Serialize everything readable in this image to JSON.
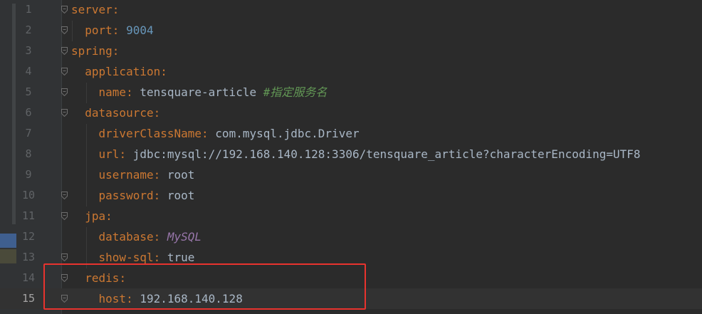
{
  "editor": {
    "language": "yaml",
    "current_line": "15",
    "lines": [
      {
        "number": "1",
        "parts": [
          {
            "t": "server",
            "c": "key"
          },
          {
            "t": ":",
            "c": "punct"
          }
        ]
      },
      {
        "number": "2",
        "parts": [
          {
            "t": "  "
          },
          {
            "t": "port",
            "c": "key"
          },
          {
            "t": ": ",
            "c": "punct"
          },
          {
            "t": "9004",
            "c": "num"
          }
        ]
      },
      {
        "number": "3",
        "parts": [
          {
            "t": "spring",
            "c": "key"
          },
          {
            "t": ":",
            "c": "punct"
          }
        ]
      },
      {
        "number": "4",
        "parts": [
          {
            "t": "  "
          },
          {
            "t": "application",
            "c": "key"
          },
          {
            "t": ":",
            "c": "punct"
          }
        ]
      },
      {
        "number": "5",
        "parts": [
          {
            "t": "    "
          },
          {
            "t": "name",
            "c": "key"
          },
          {
            "t": ": ",
            "c": "punct"
          },
          {
            "t": "tensquare-article ",
            "c": "val"
          },
          {
            "t": "#指定服务名",
            "c": "comment"
          }
        ]
      },
      {
        "number": "6",
        "parts": [
          {
            "t": "  "
          },
          {
            "t": "datasource",
            "c": "key"
          },
          {
            "t": ":",
            "c": "punct"
          }
        ]
      },
      {
        "number": "7",
        "parts": [
          {
            "t": "    "
          },
          {
            "t": "driverClassName",
            "c": "key"
          },
          {
            "t": ": ",
            "c": "punct"
          },
          {
            "t": "com.mysql.jdbc.Driver",
            "c": "val"
          }
        ]
      },
      {
        "number": "8",
        "parts": [
          {
            "t": "    "
          },
          {
            "t": "url",
            "c": "key"
          },
          {
            "t": ": ",
            "c": "punct"
          },
          {
            "t": "jdbc:mysql://192.168.140.128:3306/tensquare_article?characterEncoding=UTF8",
            "c": "val"
          }
        ]
      },
      {
        "number": "9",
        "parts": [
          {
            "t": "    "
          },
          {
            "t": "username",
            "c": "key"
          },
          {
            "t": ": ",
            "c": "punct"
          },
          {
            "t": "root",
            "c": "val"
          }
        ]
      },
      {
        "number": "10",
        "parts": [
          {
            "t": "    "
          },
          {
            "t": "password",
            "c": "key"
          },
          {
            "t": ": ",
            "c": "punct"
          },
          {
            "t": "root",
            "c": "val"
          }
        ]
      },
      {
        "number": "11",
        "parts": [
          {
            "t": "  "
          },
          {
            "t": "jpa",
            "c": "key"
          },
          {
            "t": ":",
            "c": "punct"
          }
        ]
      },
      {
        "number": "12",
        "parts": [
          {
            "t": "    "
          },
          {
            "t": "database",
            "c": "key"
          },
          {
            "t": ": ",
            "c": "punct"
          },
          {
            "t": "MySQL",
            "c": "const"
          }
        ]
      },
      {
        "number": "13",
        "parts": [
          {
            "t": "    "
          },
          {
            "t": "show-sql",
            "c": "key"
          },
          {
            "t": ": ",
            "c": "punct"
          },
          {
            "t": "true",
            "c": "val"
          }
        ]
      },
      {
        "number": "14",
        "parts": [
          {
            "t": "  "
          },
          {
            "t": "redis",
            "c": "key"
          },
          {
            "t": ":",
            "c": "punct"
          }
        ]
      },
      {
        "number": "15",
        "parts": [
          {
            "t": "    "
          },
          {
            "t": "host",
            "c": "key"
          },
          {
            "t": ": ",
            "c": "punct"
          },
          {
            "t": "192.168.140.128",
            "c": "val"
          }
        ]
      }
    ]
  },
  "fold_markers": [
    "1",
    "2",
    "3",
    "4",
    "5",
    "6",
    "10",
    "11",
    "13",
    "14",
    "15"
  ],
  "colors": {
    "background": "#2b2b2b",
    "gutter": "#313335",
    "key": "#cc7832",
    "number": "#6897bb",
    "comment": "#629755",
    "constant": "#9876aa",
    "plain": "#a9b7c6",
    "highlight_box": "#e8332e"
  },
  "annotation": {
    "highlight_box_covers_lines": [
      "14",
      "15"
    ]
  }
}
